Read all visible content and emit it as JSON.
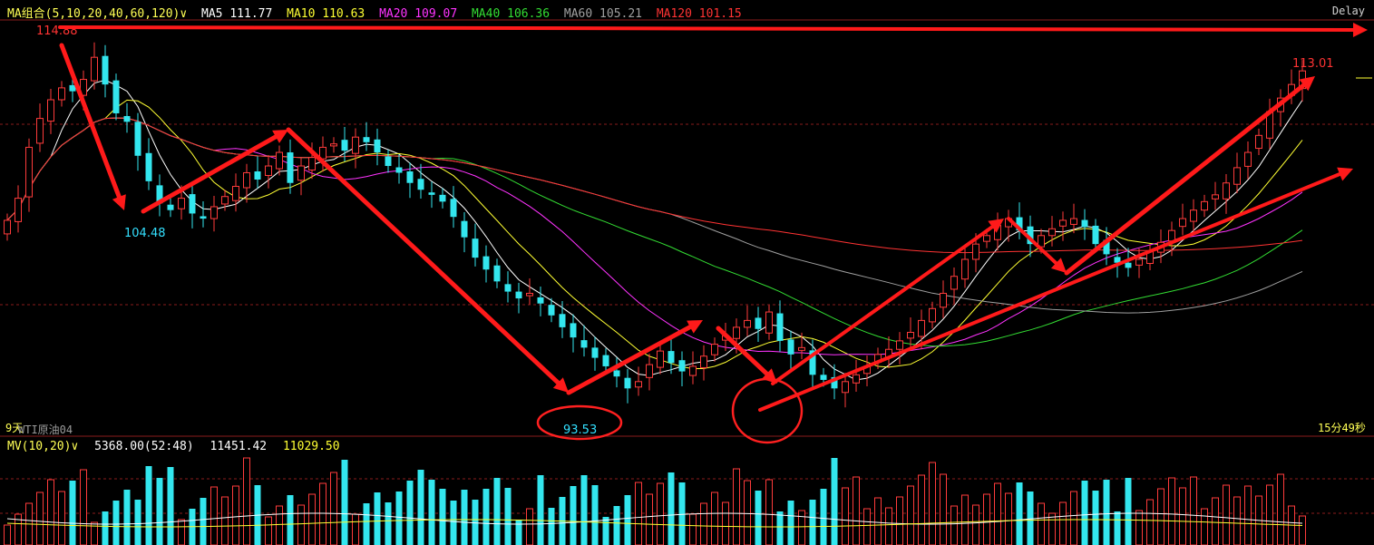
{
  "header": {
    "group_label": "MA组合(5,10,20,40,60,120)",
    "chevron": "∨",
    "indicators": [
      {
        "label": "MA5 111.77",
        "color": "#ffffff"
      },
      {
        "label": "MA10 110.63",
        "color": "#ffff33"
      },
      {
        "label": "MA20 109.07",
        "color": "#ff33ff"
      },
      {
        "label": "MA40 106.36",
        "color": "#33dd33"
      },
      {
        "label": "MA60 105.21",
        "color": "#a0a0a0"
      },
      {
        "label": "MA120 101.15",
        "color": "#ff3333"
      }
    ],
    "delay_label": "Delay"
  },
  "footer": {
    "period_label": "9天",
    "symbol_label": "WTI原油04",
    "countdown_label": "15分49秒"
  },
  "volume_header": {
    "label": "MV(10,20)",
    "chevron": "∨",
    "values": [
      "5368.00(52:48)",
      "11451.42",
      "11029.50"
    ]
  },
  "chart_data": {
    "type": "candlestick",
    "price_annotations": [
      {
        "label": "114.88",
        "color": "#ff3333"
      },
      {
        "label": "104.48",
        "color": "#33e0ff"
      },
      {
        "label": "93.53",
        "color": "#33e0ff"
      },
      {
        "label": "113.01",
        "color": "#ff3333"
      }
    ],
    "closes": [
      104.2,
      105.5,
      108.5,
      110.2,
      111.3,
      112.0,
      111.8,
      112.5,
      113.8,
      112.2,
      110.5,
      110.0,
      108.0,
      106.5,
      105.2,
      104.8,
      105.5,
      104.6,
      104.3,
      105.0,
      105.6,
      106.2,
      107.0,
      106.6,
      107.4,
      108.2,
      106.4,
      107.4,
      107.9,
      108.5,
      108.7,
      108.3,
      109.1,
      108.8,
      108.2,
      107.4,
      107.0,
      106.4,
      106.0,
      105.7,
      105.3,
      104.4,
      103.2,
      102.0,
      101.3,
      100.6,
      100.0,
      99.6,
      99.9,
      99.3,
      98.6,
      97.9,
      97.3,
      96.7,
      96.1,
      95.6,
      95.0,
      94.3,
      94.7,
      95.7,
      96.5,
      95.8,
      95.3,
      95.6,
      96.2,
      96.9,
      97.4,
      97.9,
      98.3,
      97.8,
      98.8,
      97.1,
      96.3,
      96.7,
      95.1,
      94.8,
      94.3,
      94.7,
      95.1,
      95.6,
      96.3,
      96.6,
      97.1,
      97.6,
      98.3,
      99.0,
      99.9,
      100.9,
      101.9,
      102.8,
      103.3,
      103.9,
      104.3,
      103.6,
      102.8,
      103.3,
      103.7,
      104.2,
      104.3,
      103.8,
      102.8,
      102.2,
      101.7,
      101.4,
      101.9,
      102.4,
      102.9,
      103.6,
      104.3,
      104.8,
      105.3,
      105.7,
      106.4,
      107.3,
      108.2,
      109.2,
      110.6,
      111.4,
      112.2,
      113.0
    ],
    "ma_series": [
      {
        "name": "MA5",
        "color": "#ffffff",
        "window": 5
      },
      {
        "name": "MA10",
        "color": "#ffff33",
        "window": 10
      },
      {
        "name": "MA20",
        "color": "#ff33ff",
        "window": 20
      },
      {
        "name": "MA40",
        "color": "#33dd33",
        "window": 40
      },
      {
        "name": "MA60",
        "color": "#a0a0a0",
        "window": 60
      },
      {
        "name": "MA120",
        "color": "#ff3333",
        "window": 120
      }
    ]
  }
}
